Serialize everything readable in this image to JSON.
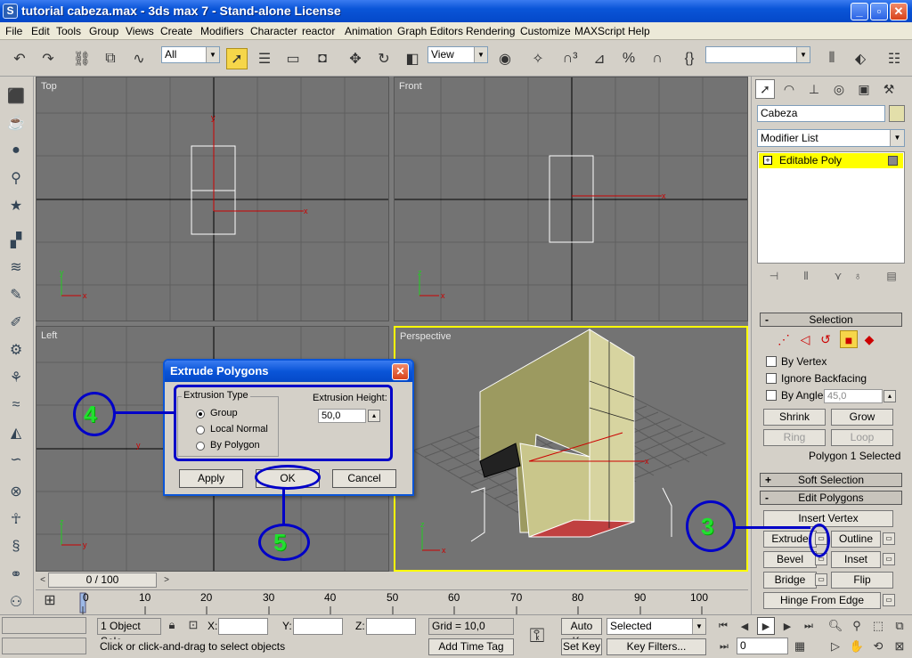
{
  "window": {
    "title": "tutorial cabeza.max - 3ds max 7  - Stand-alone License",
    "app_icon": "S",
    "minimize": "_",
    "maximize": "▫",
    "close": "✕"
  },
  "menu": [
    "File",
    "Edit",
    "Tools",
    "Group",
    "Views",
    "Create",
    "Modifiers",
    "Character",
    "reactor",
    "Animation",
    "Graph Editors",
    "Rendering",
    "Customize",
    "MAXScript",
    "Help"
  ],
  "toolbar": {
    "selection_filter": "All",
    "ref_coord": "View",
    "named_selection": ""
  },
  "viewports": {
    "top": "Top",
    "front": "Front",
    "left": "Left",
    "perspective": "Perspective"
  },
  "command_panel": {
    "object_name": "Cabeza",
    "object_color": "#e3dfaa",
    "modifier_list": "Modifier List",
    "stack_item": "Editable Poly",
    "stack_item_toggle": "+",
    "selection_rollout": "Selection",
    "by_vertex": "By Vertex",
    "ignore_backfacing": "Ignore Backfacing",
    "by_angle": "By Angle:",
    "by_angle_value": "45,0",
    "shrink": "Shrink",
    "grow": "Grow",
    "ring": "Ring",
    "loop": "Loop",
    "selection_status": "Polygon 1 Selected",
    "soft_selection": "Soft Selection",
    "edit_polygons": "Edit Polygons",
    "insert_vertex": "Insert Vertex",
    "extrude": "Extrude",
    "outline": "Outline",
    "bevel": "Bevel",
    "inset": "Inset",
    "bridge": "Bridge",
    "flip": "Flip",
    "hinge_from_edge": "Hinge From Edge",
    "minus": "-",
    "plus": "+"
  },
  "dialog": {
    "title": "Extrude Polygons",
    "close": "✕",
    "extrusion_type_label": "Extrusion Type",
    "options": [
      "Group",
      "Local Normal",
      "By Polygon"
    ],
    "selected_option": "Group",
    "extrusion_height_label": "Extrusion Height:",
    "extrusion_height_value": "50,0",
    "apply": "Apply",
    "ok": "OK",
    "cancel": "Cancel"
  },
  "annotations": {
    "step3": "3",
    "step4": "4",
    "step5": "5"
  },
  "timeline": {
    "frame_display": "0 / 100",
    "prev": "<",
    "next": ">",
    "ticks": [
      "0",
      "10",
      "20",
      "30",
      "40",
      "50",
      "60",
      "70",
      "80",
      "90",
      "100"
    ]
  },
  "status": {
    "objects_selected": "1 Object Sele",
    "x_label": "X:",
    "y_label": "Y:",
    "z_label": "Z:",
    "grid": "Grid = 10,0",
    "prompt": "Click or click-and-drag to select objects",
    "add_time_tag": "Add Time Tag",
    "auto_key": "Auto Key",
    "set_key": "Set Key",
    "key_mode": "Selected",
    "key_filters": "Key Filters...",
    "current_frame": "0"
  }
}
